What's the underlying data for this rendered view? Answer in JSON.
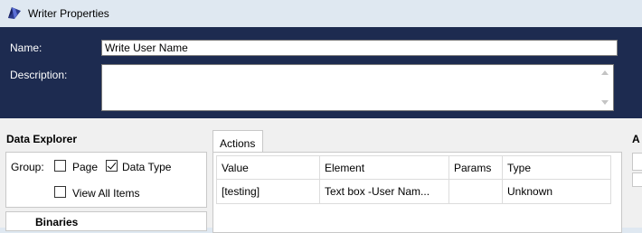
{
  "window": {
    "title": "Writer Properties",
    "icon": "writer-icon"
  },
  "header": {
    "name_label": "Name:",
    "name_value": "Write User Name",
    "description_label": "Description:",
    "description_value": ""
  },
  "data_explorer": {
    "title": "Data Explorer",
    "group_label": "Group:",
    "page_label": "Page",
    "page_checked": false,
    "data_type_label": "Data Type",
    "data_type_checked": true,
    "view_all_label": "View All Items",
    "view_all_checked": false,
    "binaries_label": "Binaries"
  },
  "actions": {
    "tab_label": "Actions",
    "columns": [
      "Value",
      "Element",
      "Params",
      "Type"
    ],
    "rows": [
      {
        "value": "[testing]",
        "element": "Text box -User Nam...",
        "params": "",
        "type": "Unknown"
      }
    ]
  },
  "right_panel": {
    "title_fragment": "A"
  }
}
